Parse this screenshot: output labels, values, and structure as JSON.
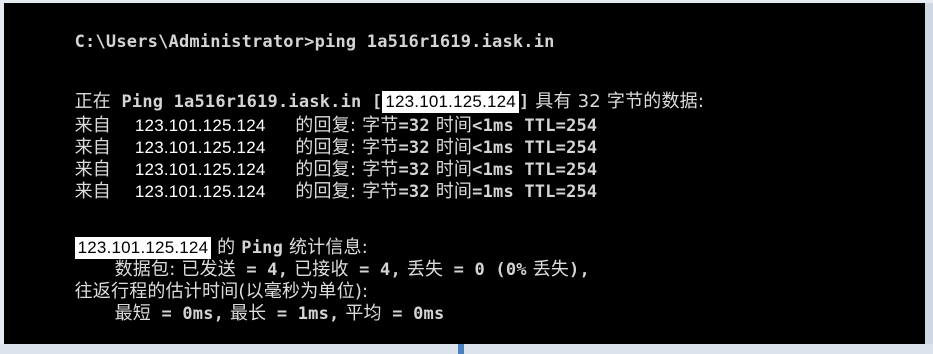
{
  "console": {
    "prompt": "C:\\Users\\Administrator>ping 1a516r1619.iask.in",
    "header": {
      "zh_start": "正在",
      "ping_text": " Ping 1a516r1619.iask.in [",
      "ip": "123.101.125.124",
      "bracket_close": "]",
      "zh_has": " 具有 ",
      "bytes": "32",
      "zh_bytes": " 字节的数据:"
    },
    "replies": [
      {
        "zh_from": "来自",
        "ip": "123.101.125.124",
        "zh_reply": " 的回复: 字节",
        "bytes": "=32",
        "zh_time": " 时间",
        "time": "<1ms",
        "ttl": " TTL=254"
      },
      {
        "zh_from": "来自",
        "ip": "123.101.125.124",
        "zh_reply": " 的回复: 字节",
        "bytes": "=32",
        "zh_time": " 时间",
        "time": "<1ms",
        "ttl": " TTL=254"
      },
      {
        "zh_from": "来自",
        "ip": "123.101.125.124",
        "zh_reply": " 的回复: 字节",
        "bytes": "=32",
        "zh_time": " 时间",
        "time": "<1ms",
        "ttl": " TTL=254"
      },
      {
        "zh_from": "来自",
        "ip": "123.101.125.124",
        "zh_reply": " 的回复: 字节",
        "bytes": "=32",
        "zh_time": " 时间",
        "time": "=1ms",
        "ttl": " TTL=254"
      }
    ],
    "stats": {
      "ip": "123.101.125.124",
      "zh_of": " 的 ",
      "ping_word": "Ping",
      "zh_stats": " 统计信息:"
    },
    "packets": {
      "zh_packets": "数据包: 已发送",
      "sent": " = 4,",
      "zh_received": " 已接收",
      "received": " = 4,",
      "zh_lost": " 丢失",
      "lost": " = 0 (0%",
      "zh_lost2": " 丢失",
      "close": "),"
    },
    "rtt_header": "往返行程的估计时间(以毫秒为单位):",
    "rtt": {
      "zh_min": "最短",
      "min": " = 0ms,",
      "zh_max": " 最长",
      "max": " = 1ms,",
      "zh_avg": " 平均",
      "avg": " = 0ms"
    }
  }
}
